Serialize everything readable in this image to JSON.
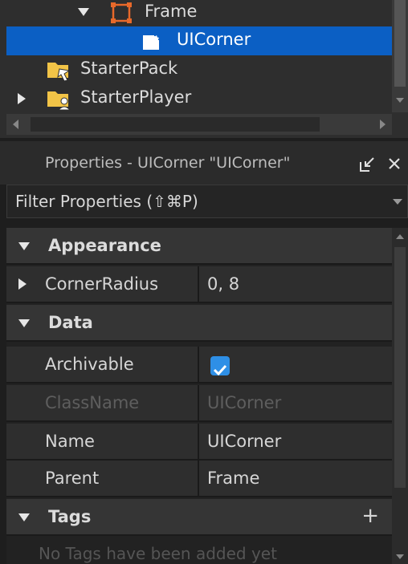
{
  "explorer": {
    "items": [
      {
        "label": "Frame",
        "icon": "frame-icon",
        "expanded": true,
        "selected": false
      },
      {
        "label": "UICorner",
        "icon": "uicorner-icon",
        "selected": true
      },
      {
        "label": "StarterPack",
        "icon": "starterpack-folder-icon",
        "selected": false
      },
      {
        "label": "StarterPlayer",
        "icon": "starterplayer-folder-icon",
        "expanded": false,
        "selected": false
      }
    ]
  },
  "properties": {
    "title": "Properties - UICorner \"UICorner\"",
    "filter_placeholder": "Filter Properties (⇧⌘P)",
    "categories": {
      "appearance": "Appearance",
      "data": "Data",
      "tags": "Tags"
    },
    "rows": {
      "corner_radius": {
        "name": "CornerRadius",
        "value": "0, 8"
      },
      "archivable": {
        "name": "Archivable",
        "checked": true
      },
      "class_name": {
        "name": "ClassName",
        "value": "UICorner"
      },
      "name": {
        "name": "Name",
        "value": "UICorner"
      },
      "parent": {
        "name": "Parent",
        "value": "Frame"
      }
    },
    "tags_empty": "No Tags have been added yet"
  },
  "colors": {
    "selection": "#0b5fc4",
    "checkbox": "#2e8fe6",
    "frame_icon": "#e8692a",
    "folder_icon": "#f2c447"
  }
}
